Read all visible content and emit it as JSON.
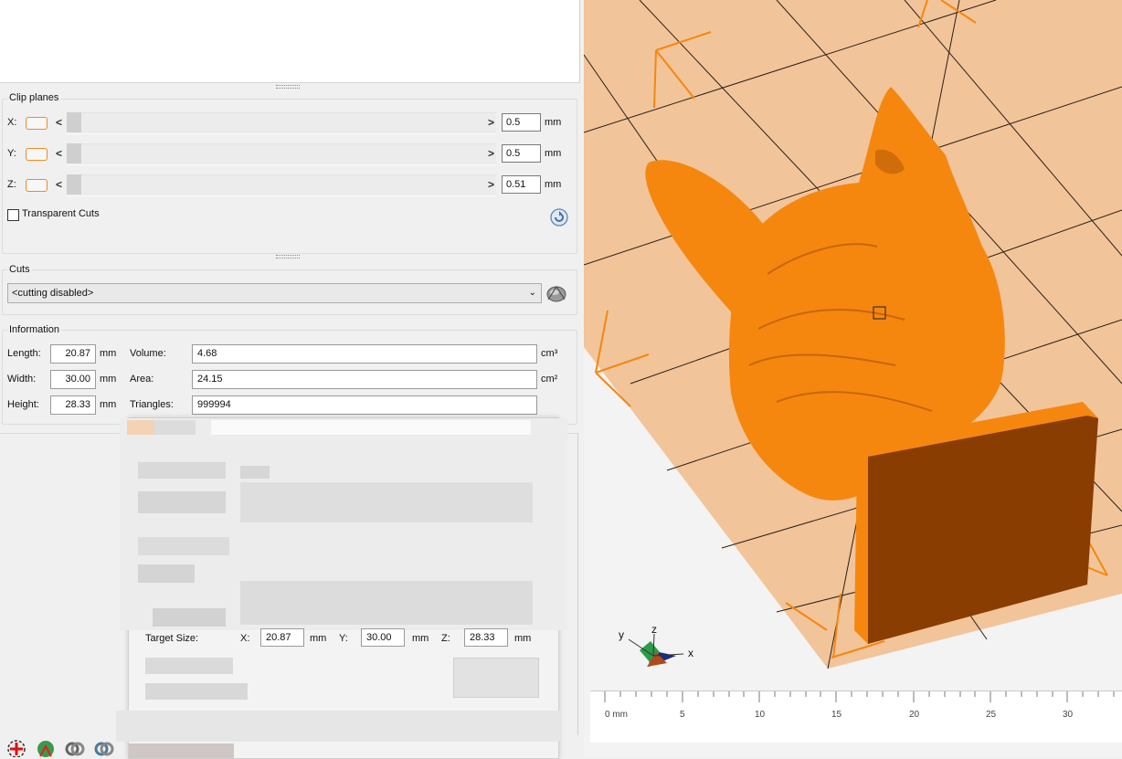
{
  "clip_planes": {
    "title": "Clip planes",
    "rows": [
      {
        "axis": "X:",
        "value": "0.5",
        "unit": "mm"
      },
      {
        "axis": "Y:",
        "value": "0.5",
        "unit": "mm"
      },
      {
        "axis": "Z:",
        "value": "0.51",
        "unit": "mm"
      }
    ],
    "left_arrow": "<",
    "right_arrow": ">",
    "transparent_cuts_label": "Transparent Cuts",
    "transparent_cuts_checked": false
  },
  "cuts": {
    "title": "Cuts",
    "selected": "<cutting disabled>"
  },
  "information": {
    "title": "Information",
    "length_label": "Length:",
    "length_value": "20.87",
    "length_unit": "mm",
    "width_label": "Width:",
    "width_value": "30.00",
    "width_unit": "mm",
    "height_label": "Height:",
    "height_value": "28.33",
    "height_unit": "mm",
    "volume_label": "Volume:",
    "volume_value": "4.68",
    "volume_unit": "cm³",
    "area_label": "Area:",
    "area_value": "24.15",
    "area_unit": "cm²",
    "triangles_label": "Triangles:",
    "triangles_value": "999994"
  },
  "dialog": {
    "target_size_label": "Target Size:",
    "x_label": "X:",
    "x_value": "20.87",
    "x_unit": "mm",
    "y_label": "Y:",
    "y_value": "30.00",
    "y_unit": "mm",
    "z_label": "Z:",
    "z_value": "28.33",
    "z_unit": "mm"
  },
  "viewport": {
    "axes": {
      "x": "x",
      "y": "y",
      "z": "z"
    },
    "ruler_labels": [
      "0 mm",
      "5",
      "10",
      "15",
      "20",
      "25",
      "30"
    ],
    "model_color": "#f5870f",
    "plate_color": "#f2c49a"
  }
}
